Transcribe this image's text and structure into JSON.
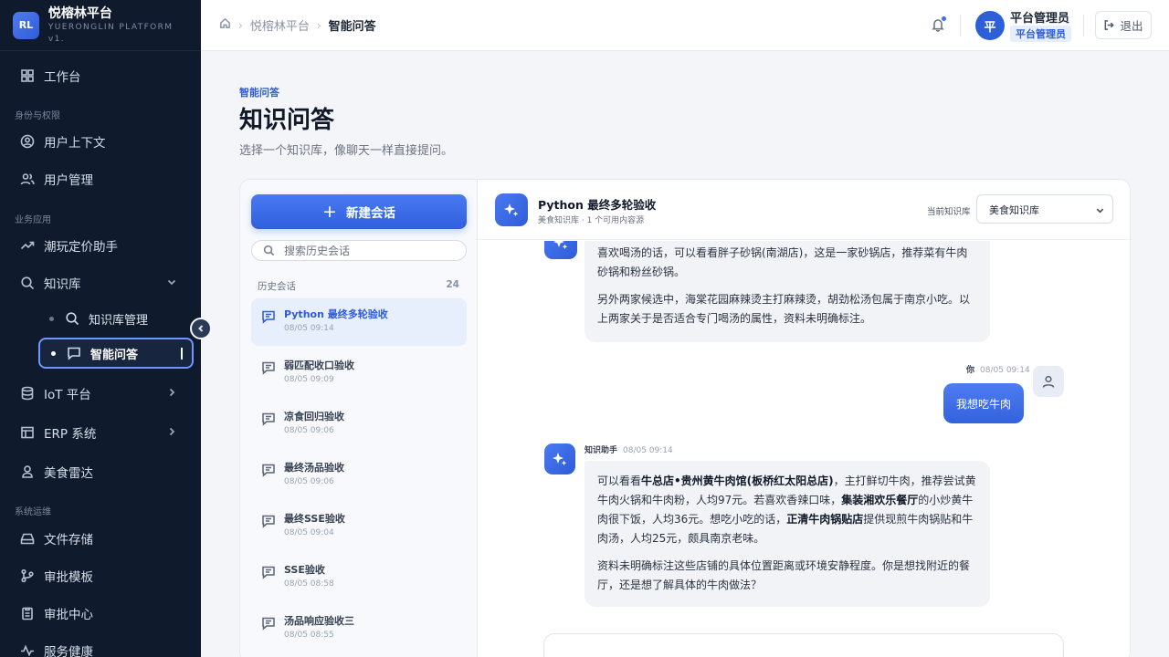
{
  "brand": {
    "logo": "RL",
    "title": "悦榕林平台",
    "subtitle": "YUERONGLIN PLATFORM v1."
  },
  "sidebar": {
    "workbench": "工作台",
    "section_identity": "身份与权限",
    "user_context": "用户上下文",
    "user_mgmt": "用户管理",
    "section_business": "业务应用",
    "pricing": "潮玩定价助手",
    "kb": "知识库",
    "kb_manage": "知识库管理",
    "kb_qa": "智能问答",
    "iot": "IoT 平台",
    "erp": "ERP 系统",
    "food_radar": "美食雷达",
    "section_ops": "系统运维",
    "file_storage": "文件存储",
    "approval_tpl": "审批模板",
    "approval_center": "审批中心",
    "service_health": "服务健康"
  },
  "topbar": {
    "crumb_root": "悦榕林平台",
    "crumb_current": "智能问答",
    "avatar": "平",
    "user_name": "平台管理员",
    "user_role": "平台管理员",
    "logout": "退出"
  },
  "page": {
    "eyebrow": "智能问答",
    "title": "知识问答",
    "desc": "选择一个知识库，像聊天一样直接提问。"
  },
  "history": {
    "new_chat": "新建会话",
    "search_placeholder": "搜索历史会话",
    "label": "历史会话",
    "count": "24",
    "items": [
      {
        "title": "Python 最终多轮验收",
        "time": "08/05 09:14"
      },
      {
        "title": "弱匹配收口验收",
        "time": "08/05 09:09"
      },
      {
        "title": "凉食回归验收",
        "time": "08/05 09:06"
      },
      {
        "title": "最终汤品验收",
        "time": "08/05 09:06"
      },
      {
        "title": "最终SSE验收",
        "time": "08/05 09:04"
      },
      {
        "title": "SSE验收",
        "time": "08/05 08:58"
      },
      {
        "title": "汤品响应验收三",
        "time": "08/05 08:55"
      }
    ]
  },
  "chat": {
    "title": "Python 最终多轮验收",
    "subtitle": "美食知识库 · 1 个可用内容源",
    "kb_label": "当前知识库",
    "kb_value": "美食知识库",
    "msg1_p1": "喜欢喝汤的话，可以看看胖子砂锅(南湖店)，这是一家砂锅店，推荐菜有牛肉砂锅和粉丝砂锅。",
    "msg1_p2": "另外两家候选中，海棠花园麻辣烫主打麻辣烫，胡劲松汤包属于南京小吃。以上两家关于是否适合专门喝汤的属性，资料未明确标注。",
    "user_name": "你",
    "user_time": "08/05 09:14",
    "user_msg": "我想吃牛肉",
    "bot_name": "知识助手",
    "bot_time": "08/05 09:14",
    "r_a": "可以看看",
    "r_b": "牛总店•贵州黄牛肉馆(板桥红太阳总店)",
    "r_c": "，主打鲜切牛肉，推荐尝试黄牛肉火锅和牛肉粉，人均97元。若喜欢香辣口味，",
    "r_d": "集装湘欢乐餐厅",
    "r_e": "的小炒黄牛肉很下饭，人均36元。想吃小吃的话，",
    "r_f": "正清牛肉锅贴店",
    "r_g": "提供现煎牛肉锅贴和牛肉汤，人均25元，颇具南京老味。",
    "r_p2": "资料未明确标注这些店铺的具体位置距离或环境安静程度。你是想找附近的餐厅，还是想了解具体的牛肉做法？"
  }
}
